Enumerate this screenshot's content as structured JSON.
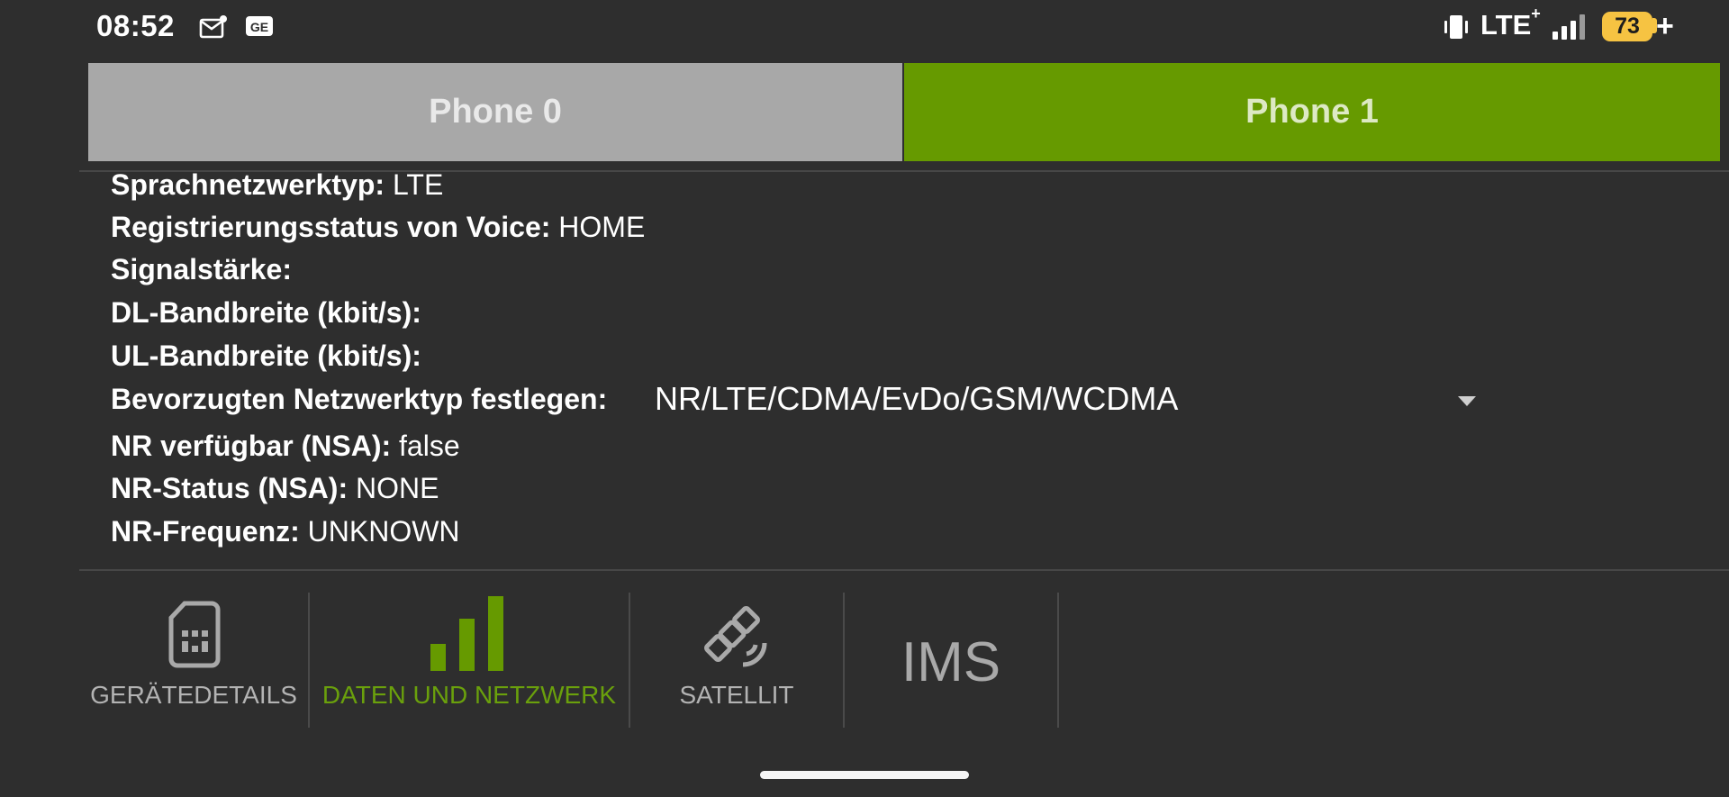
{
  "status_bar": {
    "time": "08:52",
    "left_icons": [
      "mail-icon",
      "ge-app-icon"
    ],
    "right_icons": [
      "vibrate-icon",
      "signal-bars-icon"
    ],
    "network_type": "LTE",
    "network_type_suffix": "+",
    "battery_level": "73",
    "battery_color": "#f6c342",
    "charging_symbol": "+"
  },
  "phone_tabs": [
    {
      "label": "Phone 0",
      "selected": false,
      "color": "#a8a8a8"
    },
    {
      "label": "Phone 1",
      "selected": true,
      "color": "#669a00"
    }
  ],
  "info": {
    "voice_network_type": {
      "label": "Sprachnetzwerktyp:",
      "value": "LTE"
    },
    "voice_registration": {
      "label": "Registrierungsstatus von Voice:",
      "value": "HOME"
    },
    "signal_strength": {
      "label": "Signalstärke:",
      "value": ""
    },
    "dl_bandwidth": {
      "label": "DL-Bandbreite (kbit/s):",
      "value": ""
    },
    "ul_bandwidth": {
      "label": "UL-Bandbreite (kbit/s):",
      "value": ""
    },
    "preferred_network": {
      "label": "Bevorzugten Netzwerktyp festlegen:",
      "value": "NR/LTE/CDMA/EvDo/GSM/WCDMA"
    },
    "nr_available": {
      "label": "NR verfügbar (NSA):",
      "value": "false"
    },
    "nr_state": {
      "label": "NR-Status (NSA):",
      "value": "NONE"
    },
    "nr_frequency": {
      "label": "NR-Frequenz:",
      "value": "UNKNOWN"
    }
  },
  "bottom_nav": [
    {
      "label": "GERÄTEDETAILS",
      "icon": "sim-card-icon",
      "active": false
    },
    {
      "label": "DATEN UND NETZWERK",
      "icon": "signal-bars-icon",
      "active": true
    },
    {
      "label": "SATELLIT",
      "icon": "satellite-icon",
      "active": false
    },
    {
      "label": "IMS",
      "icon": "",
      "active": false
    }
  ],
  "accent_color": "#669a00"
}
